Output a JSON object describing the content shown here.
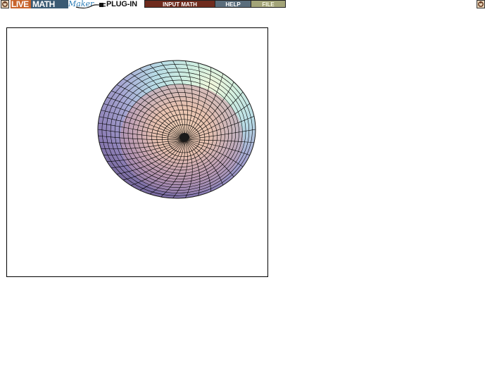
{
  "toolbar": {
    "logo": {
      "live": "LIVE",
      "math": "MATH",
      "maker": "Maker"
    },
    "plugin_label": "PLUG-IN",
    "buttons": {
      "input_math": "INPUT MATH",
      "help": "HELP",
      "file": "FILE"
    },
    "left_icon": "toggle-icon",
    "right_icon": "toggle-icon"
  },
  "plot": {
    "type": "3d-surface-plot",
    "surface": "torus-like-sphere",
    "colors": {
      "mesh_line": "#000000",
      "frame": "#000000"
    }
  }
}
